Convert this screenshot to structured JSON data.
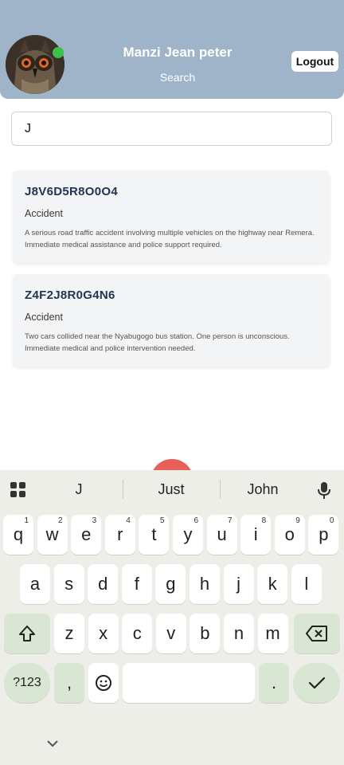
{
  "header": {
    "user_name": "Manzi Jean peter",
    "subtitle": "Search",
    "logout_label": "Logout",
    "status_color": "#3cc14a"
  },
  "search": {
    "value": "J"
  },
  "results": [
    {
      "id": "J8V6D5R8O0O4",
      "type": "Accident",
      "description": "A serious road traffic accident involving multiple vehicles on the highway near Remera. Immediate medical assistance and police support required."
    },
    {
      "id": "Z4F2J8R0G4N6",
      "type": "Accident",
      "description": "Two cars collided near the Nyabugogo bus station. One person is unconscious. Immediate medical and police intervention needed."
    }
  ],
  "keyboard": {
    "suggestions": [
      "J",
      "Just",
      "John"
    ],
    "row1": [
      {
        "key": "q",
        "hint": "1"
      },
      {
        "key": "w",
        "hint": "2"
      },
      {
        "key": "e",
        "hint": "3"
      },
      {
        "key": "r",
        "hint": "4"
      },
      {
        "key": "t",
        "hint": "5"
      },
      {
        "key": "y",
        "hint": "6"
      },
      {
        "key": "u",
        "hint": "7"
      },
      {
        "key": "i",
        "hint": "8"
      },
      {
        "key": "o",
        "hint": "9"
      },
      {
        "key": "p",
        "hint": "0"
      }
    ],
    "row2": [
      "a",
      "s",
      "d",
      "f",
      "g",
      "h",
      "j",
      "k",
      "l"
    ],
    "row3": [
      "z",
      "x",
      "c",
      "v",
      "b",
      "n",
      "m"
    ],
    "symbols_label": "?123",
    "comma_label": ",",
    "period_label": "."
  }
}
